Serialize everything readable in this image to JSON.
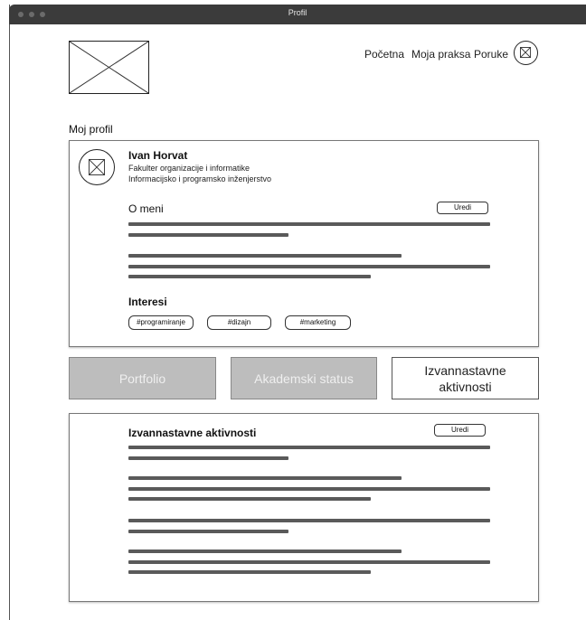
{
  "window": {
    "title": "Profil"
  },
  "nav": {
    "links": [
      "Početna",
      "Moja praksa",
      "Poruke"
    ]
  },
  "page": {
    "section_title": "Moj profil"
  },
  "profile": {
    "name": "Ivan Horvat",
    "faculty": "Fakulter organizacije i informatike",
    "program": "Informacijsko i programsko inženjerstvo",
    "about_heading": "O meni",
    "edit_label": "Uredi",
    "interests_heading": "Interesi",
    "tags": [
      "#programiranje",
      "#dizajn",
      "#marketing"
    ]
  },
  "tabs": [
    "Portfolio",
    "Akademski status",
    "Izvannastavne aktivnosti"
  ],
  "activities": {
    "heading": "Izvannastavne aktivnosti",
    "edit_label": "Uredi"
  },
  "colors": {
    "titlebar": "#3b3b3b",
    "placeholder_line": "#5a5a5a",
    "inactive_tab": "#bdbdbd"
  }
}
